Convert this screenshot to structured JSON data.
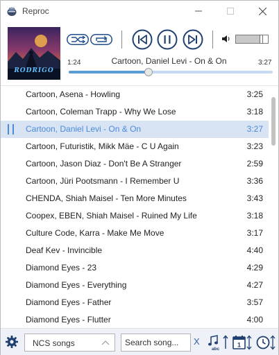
{
  "window": {
    "title": "Reproc",
    "app_icon": "bomb-icon"
  },
  "player": {
    "cover_text": "RODRIGO",
    "current_time": "1:24",
    "total_time": "3:27",
    "now_playing": "Cartoon, Daniel Levi - On & On",
    "progress": 0.39,
    "volume": 0.8
  },
  "controls": {
    "shuffle_icon": "shuffle-icon",
    "repeat_icon": "repeat-icon",
    "prev_icon": "skip-previous-icon",
    "pause_icon": "pause-icon",
    "next_icon": "skip-next-icon",
    "volume_icon": "speaker-icon"
  },
  "playlist": {
    "active_index": 2,
    "tracks": [
      {
        "title": "Cartoon, Asena - Howling",
        "duration": "3:25"
      },
      {
        "title": "Cartoon, Coleman Trapp - Why We Lose",
        "duration": "3:18"
      },
      {
        "title": "Cartoon, Daniel Levi - On & On",
        "duration": "3:27"
      },
      {
        "title": "Cartoon, Futuristik, Mikk Mäe - C U Again",
        "duration": "3:23"
      },
      {
        "title": "Cartoon, Jason Diaz - Don't Be A Stranger",
        "duration": "2:59"
      },
      {
        "title": "Cartoon, Jüri Pootsmann - I Remember U",
        "duration": "3:36"
      },
      {
        "title": "CHENDA, Shiah Maisel - Ten More Minutes",
        "duration": "3:43"
      },
      {
        "title": "Coopex, EBEN, Shiah Maisel - Ruined My Life",
        "duration": "3:18"
      },
      {
        "title": "Culture Code, Karra - Make Me Move",
        "duration": "3:17"
      },
      {
        "title": "Deaf Kev - Invincible",
        "duration": "4:40"
      },
      {
        "title": "Diamond Eyes - 23",
        "duration": "4:29"
      },
      {
        "title": "Diamond Eyes - Everything",
        "duration": "4:27"
      },
      {
        "title": "Diamond Eyes - Father",
        "duration": "3:57"
      },
      {
        "title": "Diamond Eyes - Flutter",
        "duration": "4:00"
      }
    ]
  },
  "footer": {
    "playlist_select": "NCS songs",
    "search_placeholder": "Search song...",
    "clear_label": "X",
    "sort_abc_label": "abc",
    "sort_date_label": "1",
    "accent_color": "#3a6fc0"
  }
}
